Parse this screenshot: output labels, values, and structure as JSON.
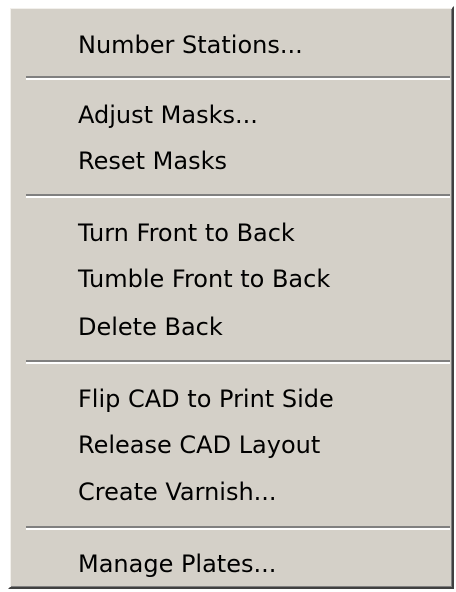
{
  "menu": {
    "items": [
      {
        "label": "Number Stations..."
      },
      {
        "label": "Adjust Masks..."
      },
      {
        "label": "Reset Masks"
      },
      {
        "label": "Turn Front to Back"
      },
      {
        "label": "Tumble Front to Back"
      },
      {
        "label": "Delete Back"
      },
      {
        "label": "Flip CAD to Print Side"
      },
      {
        "label": "Release CAD Layout"
      },
      {
        "label": "Create Varnish..."
      },
      {
        "label": "Manage Plates..."
      }
    ]
  }
}
